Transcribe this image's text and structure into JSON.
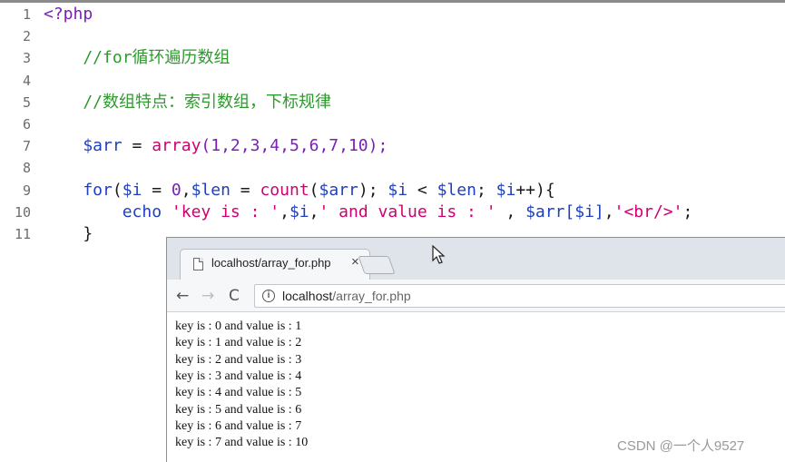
{
  "editor": {
    "lines": [
      {
        "num": "1",
        "segments": [
          {
            "text": "<?php",
            "color": "#7a1fb5"
          }
        ]
      },
      {
        "num": "2",
        "segments": []
      },
      {
        "num": "3",
        "segments": [
          {
            "text": "    //for循环遍历数组",
            "color": "#2e9a2e"
          }
        ]
      },
      {
        "num": "4",
        "segments": []
      },
      {
        "num": "5",
        "segments": [
          {
            "text": "    //数组特点：索引数组，下标规律",
            "color": "#2e9a2e"
          }
        ]
      },
      {
        "num": "6",
        "segments": []
      },
      {
        "num": "7",
        "segments": [
          {
            "text": "    $arr",
            "color": "#1f3fbf"
          },
          {
            "text": " = ",
            "color": "#1a1a1a"
          },
          {
            "text": "array",
            "color": "#d0006f"
          },
          {
            "text": "(1,2,3,4,5,6,7,10);",
            "color": "#7a1fb5"
          }
        ]
      },
      {
        "num": "8",
        "segments": []
      },
      {
        "num": "9",
        "segments": [
          {
            "text": "    for",
            "color": "#1f3fbf"
          },
          {
            "text": "(",
            "color": "#1a1a1a"
          },
          {
            "text": "$i",
            "color": "#1f3fbf"
          },
          {
            "text": " = ",
            "color": "#1a1a1a"
          },
          {
            "text": "0",
            "color": "#7a1fb5"
          },
          {
            "text": ",",
            "color": "#1a1a1a"
          },
          {
            "text": "$len",
            "color": "#1f3fbf"
          },
          {
            "text": " = ",
            "color": "#1a1a1a"
          },
          {
            "text": "count",
            "color": "#d0006f"
          },
          {
            "text": "(",
            "color": "#1a1a1a"
          },
          {
            "text": "$arr",
            "color": "#1f3fbf"
          },
          {
            "text": "); ",
            "color": "#1a1a1a"
          },
          {
            "text": "$i",
            "color": "#1f3fbf"
          },
          {
            "text": " < ",
            "color": "#1a1a1a"
          },
          {
            "text": "$len",
            "color": "#1f3fbf"
          },
          {
            "text": "; ",
            "color": "#1a1a1a"
          },
          {
            "text": "$i",
            "color": "#1f3fbf"
          },
          {
            "text": "++){",
            "color": "#1a1a1a"
          }
        ]
      },
      {
        "num": "10",
        "segments": [
          {
            "text": "        echo ",
            "color": "#1f3fbf"
          },
          {
            "text": "'key is : '",
            "color": "#d0006f"
          },
          {
            "text": ",",
            "color": "#1a1a1a"
          },
          {
            "text": "$i",
            "color": "#1f3fbf"
          },
          {
            "text": ",",
            "color": "#1a1a1a"
          },
          {
            "text": "' and value is : '",
            "color": "#d0006f"
          },
          {
            "text": " , ",
            "color": "#1a1a1a"
          },
          {
            "text": "$arr[$i]",
            "color": "#1f3fbf"
          },
          {
            "text": ",",
            "color": "#1a1a1a"
          },
          {
            "text": "'<br/>'",
            "color": "#d0006f"
          },
          {
            "text": ";",
            "color": "#1a1a1a"
          }
        ]
      },
      {
        "num": "11",
        "segments": [
          {
            "text": "    }",
            "color": "#1a1a1a"
          }
        ]
      }
    ]
  },
  "browser": {
    "tab": {
      "title": "localhost/array_for.php",
      "close": "×"
    },
    "nav": {
      "back": "←",
      "forward": "→",
      "reload": "C"
    },
    "address": {
      "info": "i",
      "host": "localhost",
      "path": "/array_for.php"
    },
    "output": [
      "key is : 0 and value is : 1",
      "key is : 1 and value is : 2",
      "key is : 2 and value is : 3",
      "key is : 3 and value is : 4",
      "key is : 4 and value is : 5",
      "key is : 5 and value is : 6",
      "key is : 6 and value is : 7",
      "key is : 7 and value is : 10"
    ]
  },
  "watermark": "CSDN @一个人9527"
}
